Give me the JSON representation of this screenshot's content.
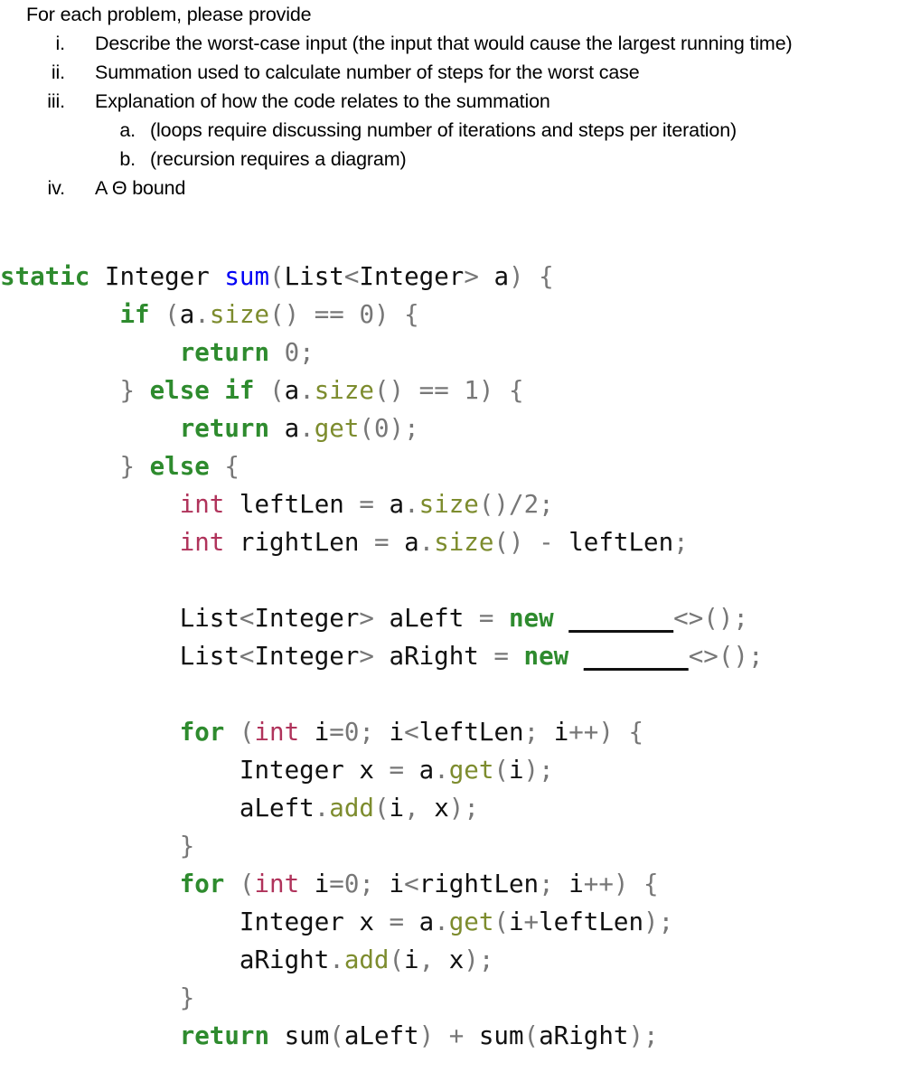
{
  "instructions": {
    "lead_in": "For each problem, please provide",
    "items": [
      {
        "marker": "i.",
        "text": "Describe the worst-case input (the input that would cause the largest running time)",
        "level": "roman"
      },
      {
        "marker": "ii.",
        "text": "Summation used to calculate number of steps for the worst case",
        "level": "roman"
      },
      {
        "marker": "iii.",
        "text": "Explanation of how the code relates to the summation",
        "level": "roman"
      },
      {
        "marker": "a.",
        "text": "(loops require discussing number of iterations and steps per iteration)",
        "level": "alpha"
      },
      {
        "marker": "b.",
        "text": "(recursion requires a diagram)",
        "level": "alpha"
      },
      {
        "marker": "iv.",
        "text": "A Θ bound",
        "level": "roman"
      }
    ]
  },
  "code": {
    "language": "java",
    "colors": {
      "keyword": "#2e8b2e",
      "type": "#b0335b",
      "function_declaration": "#0000f5",
      "method_call": "#7d8c2e",
      "punctuation": "#777777",
      "number": "#777777",
      "identifier": "#111111",
      "background": "#ffffff"
    },
    "lines": [
      "static Integer sum(List<Integer> a) {",
      "        if (a.size() == 0) {",
      "            return 0;",
      "        } else if (a.size() == 1) {",
      "            return a.get(0);",
      "        } else {",
      "            int leftLen = a.size()/2;",
      "            int rightLen = a.size() - leftLen;",
      "",
      "            List<Integer> aLeft = new _______<>();",
      "            List<Integer> aRight = new _______<>();",
      "",
      "            for (int i=0; i<leftLen; i++) {",
      "                Integer x = a.get(i);",
      "                aLeft.add(i, x);",
      "            }",
      "            for (int i=0; i<rightLen; i++) {",
      "                Integer x = a.get(i+leftLen);",
      "                aRight.add(i, x);",
      "            }",
      "            return sum(aLeft) + sum(aRight);"
    ],
    "tokens": [
      [
        [
          "static",
          "kw"
        ],
        [
          " ",
          "plain"
        ],
        [
          "Integer",
          "plain"
        ],
        [
          " ",
          "plain"
        ],
        [
          "sum",
          "fn"
        ],
        [
          "(",
          "punct"
        ],
        [
          "List",
          "plain"
        ],
        [
          "<",
          "punct"
        ],
        [
          "Integer",
          "plain"
        ],
        [
          ">",
          "punct"
        ],
        [
          " ",
          "plain"
        ],
        [
          "a",
          "plain"
        ],
        [
          ")",
          "punct"
        ],
        [
          " ",
          "plain"
        ],
        [
          "{",
          "punct"
        ]
      ],
      [
        [
          "        ",
          "plain"
        ],
        [
          "if",
          "kw"
        ],
        [
          " ",
          "plain"
        ],
        [
          "(",
          "punct"
        ],
        [
          "a",
          "plain"
        ],
        [
          ".",
          "punct"
        ],
        [
          "size",
          "method"
        ],
        [
          "()",
          "punct"
        ],
        [
          " ",
          "plain"
        ],
        [
          "==",
          "punct"
        ],
        [
          " ",
          "plain"
        ],
        [
          "0",
          "num"
        ],
        [
          ")",
          "punct"
        ],
        [
          " ",
          "plain"
        ],
        [
          "{",
          "punct"
        ]
      ],
      [
        [
          "            ",
          "plain"
        ],
        [
          "return",
          "kw"
        ],
        [
          " ",
          "plain"
        ],
        [
          "0",
          "num"
        ],
        [
          ";",
          "punct"
        ]
      ],
      [
        [
          "        ",
          "plain"
        ],
        [
          "}",
          "punct"
        ],
        [
          " ",
          "plain"
        ],
        [
          "else",
          "kw"
        ],
        [
          " ",
          "plain"
        ],
        [
          "if",
          "kw"
        ],
        [
          " ",
          "plain"
        ],
        [
          "(",
          "punct"
        ],
        [
          "a",
          "plain"
        ],
        [
          ".",
          "punct"
        ],
        [
          "size",
          "method"
        ],
        [
          "()",
          "punct"
        ],
        [
          " ",
          "plain"
        ],
        [
          "==",
          "punct"
        ],
        [
          " ",
          "plain"
        ],
        [
          "1",
          "num"
        ],
        [
          ")",
          "punct"
        ],
        [
          " ",
          "plain"
        ],
        [
          "{",
          "punct"
        ]
      ],
      [
        [
          "            ",
          "plain"
        ],
        [
          "return",
          "kw"
        ],
        [
          " ",
          "plain"
        ],
        [
          "a",
          "plain"
        ],
        [
          ".",
          "punct"
        ],
        [
          "get",
          "method"
        ],
        [
          "(",
          "punct"
        ],
        [
          "0",
          "num"
        ],
        [
          ")",
          "punct"
        ],
        [
          ";",
          "punct"
        ]
      ],
      [
        [
          "        ",
          "plain"
        ],
        [
          "}",
          "punct"
        ],
        [
          " ",
          "plain"
        ],
        [
          "else",
          "kw"
        ],
        [
          " ",
          "plain"
        ],
        [
          "{",
          "punct"
        ]
      ],
      [
        [
          "            ",
          "plain"
        ],
        [
          "int",
          "type"
        ],
        [
          " ",
          "plain"
        ],
        [
          "leftLen",
          "plain"
        ],
        [
          " ",
          "plain"
        ],
        [
          "=",
          "punct"
        ],
        [
          " ",
          "plain"
        ],
        [
          "a",
          "plain"
        ],
        [
          ".",
          "punct"
        ],
        [
          "size",
          "method"
        ],
        [
          "()",
          "punct"
        ],
        [
          "/",
          "punct"
        ],
        [
          "2",
          "num"
        ],
        [
          ";",
          "punct"
        ]
      ],
      [
        [
          "            ",
          "plain"
        ],
        [
          "int",
          "type"
        ],
        [
          " ",
          "plain"
        ],
        [
          "rightLen",
          "plain"
        ],
        [
          " ",
          "plain"
        ],
        [
          "=",
          "punct"
        ],
        [
          " ",
          "plain"
        ],
        [
          "a",
          "plain"
        ],
        [
          ".",
          "punct"
        ],
        [
          "size",
          "method"
        ],
        [
          "()",
          "punct"
        ],
        [
          " ",
          "plain"
        ],
        [
          "-",
          "punct"
        ],
        [
          " ",
          "plain"
        ],
        [
          "leftLen",
          "plain"
        ],
        [
          ";",
          "punct"
        ]
      ],
      [],
      [
        [
          "            ",
          "plain"
        ],
        [
          "List",
          "plain"
        ],
        [
          "<",
          "punct"
        ],
        [
          "Integer",
          "plain"
        ],
        [
          ">",
          "punct"
        ],
        [
          " ",
          "plain"
        ],
        [
          "aLeft",
          "plain"
        ],
        [
          " ",
          "plain"
        ],
        [
          "=",
          "punct"
        ],
        [
          " ",
          "plain"
        ],
        [
          "new",
          "kw"
        ],
        [
          " ",
          "plain"
        ],
        [
          "_______",
          "blank"
        ],
        [
          "<>",
          "punct"
        ],
        [
          "()",
          "punct"
        ],
        [
          ";",
          "punct"
        ]
      ],
      [
        [
          "            ",
          "plain"
        ],
        [
          "List",
          "plain"
        ],
        [
          "<",
          "punct"
        ],
        [
          "Integer",
          "plain"
        ],
        [
          ">",
          "punct"
        ],
        [
          " ",
          "plain"
        ],
        [
          "aRight",
          "plain"
        ],
        [
          " ",
          "plain"
        ],
        [
          "=",
          "punct"
        ],
        [
          " ",
          "plain"
        ],
        [
          "new",
          "kw"
        ],
        [
          " ",
          "plain"
        ],
        [
          "_______",
          "blank"
        ],
        [
          "<>",
          "punct"
        ],
        [
          "()",
          "punct"
        ],
        [
          ";",
          "punct"
        ]
      ],
      [],
      [
        [
          "            ",
          "plain"
        ],
        [
          "for",
          "kw"
        ],
        [
          " ",
          "plain"
        ],
        [
          "(",
          "punct"
        ],
        [
          "int",
          "type"
        ],
        [
          " ",
          "plain"
        ],
        [
          "i",
          "plain"
        ],
        [
          "=",
          "punct"
        ],
        [
          "0",
          "num"
        ],
        [
          "; ",
          "punct"
        ],
        [
          "i",
          "plain"
        ],
        [
          "<",
          "punct"
        ],
        [
          "leftLen",
          "plain"
        ],
        [
          "; ",
          "punct"
        ],
        [
          "i",
          "plain"
        ],
        [
          "++",
          "punct"
        ],
        [
          ")",
          "punct"
        ],
        [
          " ",
          "plain"
        ],
        [
          "{",
          "punct"
        ]
      ],
      [
        [
          "                ",
          "plain"
        ],
        [
          "Integer",
          "plain"
        ],
        [
          " ",
          "plain"
        ],
        [
          "x",
          "plain"
        ],
        [
          " ",
          "plain"
        ],
        [
          "=",
          "punct"
        ],
        [
          " ",
          "plain"
        ],
        [
          "a",
          "plain"
        ],
        [
          ".",
          "punct"
        ],
        [
          "get",
          "method"
        ],
        [
          "(",
          "punct"
        ],
        [
          "i",
          "plain"
        ],
        [
          ")",
          "punct"
        ],
        [
          ";",
          "punct"
        ]
      ],
      [
        [
          "                ",
          "plain"
        ],
        [
          "aLeft",
          "plain"
        ],
        [
          ".",
          "punct"
        ],
        [
          "add",
          "method"
        ],
        [
          "(",
          "punct"
        ],
        [
          "i",
          "plain"
        ],
        [
          ", ",
          "punct"
        ],
        [
          "x",
          "plain"
        ],
        [
          ")",
          "punct"
        ],
        [
          ";",
          "punct"
        ]
      ],
      [
        [
          "            ",
          "plain"
        ],
        [
          "}",
          "punct"
        ]
      ],
      [
        [
          "            ",
          "plain"
        ],
        [
          "for",
          "kw"
        ],
        [
          " ",
          "plain"
        ],
        [
          "(",
          "punct"
        ],
        [
          "int",
          "type"
        ],
        [
          " ",
          "plain"
        ],
        [
          "i",
          "plain"
        ],
        [
          "=",
          "punct"
        ],
        [
          "0",
          "num"
        ],
        [
          "; ",
          "punct"
        ],
        [
          "i",
          "plain"
        ],
        [
          "<",
          "punct"
        ],
        [
          "rightLen",
          "plain"
        ],
        [
          "; ",
          "punct"
        ],
        [
          "i",
          "plain"
        ],
        [
          "++",
          "punct"
        ],
        [
          ")",
          "punct"
        ],
        [
          " ",
          "plain"
        ],
        [
          "{",
          "punct"
        ]
      ],
      [
        [
          "                ",
          "plain"
        ],
        [
          "Integer",
          "plain"
        ],
        [
          " ",
          "plain"
        ],
        [
          "x",
          "plain"
        ],
        [
          " ",
          "plain"
        ],
        [
          "=",
          "punct"
        ],
        [
          " ",
          "plain"
        ],
        [
          "a",
          "plain"
        ],
        [
          ".",
          "punct"
        ],
        [
          "get",
          "method"
        ],
        [
          "(",
          "punct"
        ],
        [
          "i",
          "plain"
        ],
        [
          "+",
          "punct"
        ],
        [
          "leftLen",
          "plain"
        ],
        [
          ")",
          "punct"
        ],
        [
          ";",
          "punct"
        ]
      ],
      [
        [
          "                ",
          "plain"
        ],
        [
          "aRight",
          "plain"
        ],
        [
          ".",
          "punct"
        ],
        [
          "add",
          "method"
        ],
        [
          "(",
          "punct"
        ],
        [
          "i",
          "plain"
        ],
        [
          ", ",
          "punct"
        ],
        [
          "x",
          "plain"
        ],
        [
          ")",
          "punct"
        ],
        [
          ";",
          "punct"
        ]
      ],
      [
        [
          "            ",
          "plain"
        ],
        [
          "}",
          "punct"
        ]
      ],
      [
        [
          "            ",
          "plain"
        ],
        [
          "return",
          "kw"
        ],
        [
          " ",
          "plain"
        ],
        [
          "sum",
          "plain"
        ],
        [
          "(",
          "punct"
        ],
        [
          "aLeft",
          "plain"
        ],
        [
          ")",
          "punct"
        ],
        [
          " ",
          "plain"
        ],
        [
          "+",
          "punct"
        ],
        [
          " ",
          "plain"
        ],
        [
          "sum",
          "plain"
        ],
        [
          "(",
          "punct"
        ],
        [
          "aRight",
          "plain"
        ],
        [
          ")",
          "punct"
        ],
        [
          ";",
          "punct"
        ]
      ]
    ]
  }
}
